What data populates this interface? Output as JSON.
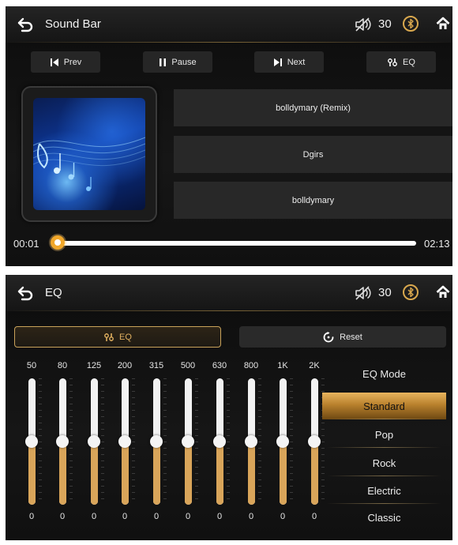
{
  "player": {
    "title": "Sound Bar",
    "volume": "30",
    "controls": {
      "prev": "Prev",
      "pause": "Pause",
      "next": "Next",
      "eq": "EQ"
    },
    "track": {
      "song": "bolldymary (Remix)",
      "artist": "Dgirs",
      "album": "bolldymary"
    },
    "elapsed": "00:01",
    "duration": "02:13",
    "progress_fraction": 0.008
  },
  "eq": {
    "title": "EQ",
    "volume": "30",
    "eq_tab": "EQ",
    "reset": "Reset",
    "bands": [
      {
        "freq": "50",
        "gain": "0"
      },
      {
        "freq": "80",
        "gain": "0"
      },
      {
        "freq": "125",
        "gain": "0"
      },
      {
        "freq": "200",
        "gain": "0"
      },
      {
        "freq": "315",
        "gain": "0"
      },
      {
        "freq": "500",
        "gain": "0"
      },
      {
        "freq": "630",
        "gain": "0"
      },
      {
        "freq": "800",
        "gain": "0"
      },
      {
        "freq": "1K",
        "gain": "0"
      },
      {
        "freq": "2K",
        "gain": "0"
      }
    ],
    "mode_title": "EQ Mode",
    "modes": [
      "Standard",
      "Pop",
      "Rock",
      "Electric",
      "Classic"
    ],
    "selected_mode": "Standard"
  },
  "colors": {
    "accent": "#d9a55a",
    "knob": "#f0a72a",
    "bar": "#282828"
  },
  "icons": [
    "back-arrow-icon",
    "mute-icon",
    "bluetooth-icon",
    "home-icon",
    "prev-icon",
    "pause-icon",
    "next-icon",
    "eq-sliders-icon",
    "reset-icon"
  ]
}
